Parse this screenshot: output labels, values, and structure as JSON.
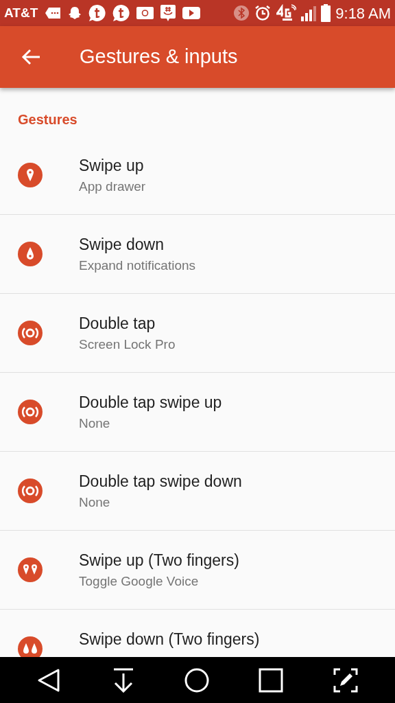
{
  "status_bar": {
    "carrier": "AT&T",
    "time": "9:18 AM"
  },
  "app_bar": {
    "title": "Gestures & inputs"
  },
  "section": {
    "title": "Gestures"
  },
  "rows": [
    {
      "kind": "pin",
      "title": "Swipe up",
      "subtitle": "App drawer"
    },
    {
      "kind": "drop",
      "title": "Swipe down",
      "subtitle": "Expand notifications"
    },
    {
      "kind": "ring",
      "title": "Double tap",
      "subtitle": "Screen Lock Pro"
    },
    {
      "kind": "ring",
      "title": "Double tap swipe up",
      "subtitle": "None"
    },
    {
      "kind": "ring",
      "title": "Double tap swipe down",
      "subtitle": "None"
    },
    {
      "kind": "pins",
      "title": "Swipe up (Two fingers)",
      "subtitle": "Toggle Google Voice"
    },
    {
      "kind": "drops",
      "title": "Swipe down (Two fingers)"
    }
  ]
}
